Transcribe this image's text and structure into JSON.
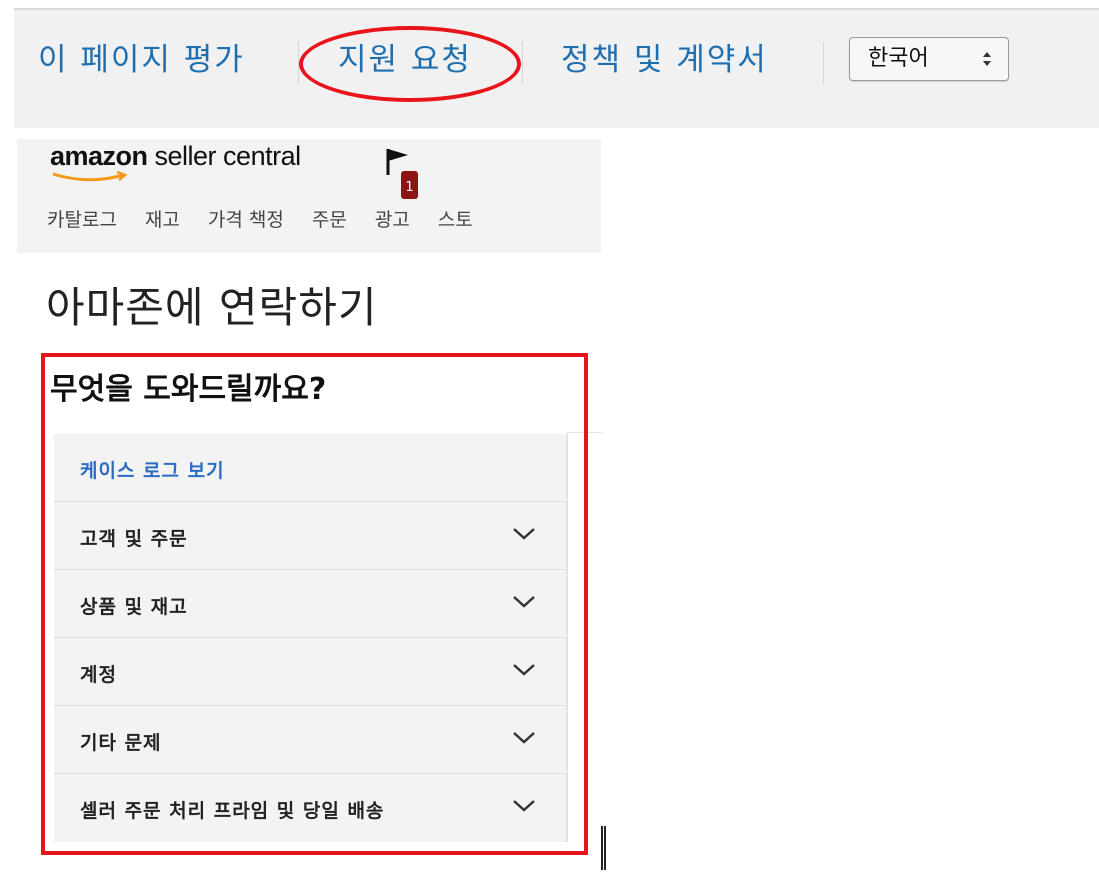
{
  "footer": {
    "links": [
      {
        "label": "이 페이지 평가"
      },
      {
        "label": "지원 요청"
      },
      {
        "label": "정책 및 계약서"
      }
    ],
    "language": "한국어"
  },
  "header": {
    "logo_bold": "amazon",
    "logo_rest": " seller central",
    "notification_count": "1",
    "nav": [
      "카탈로그",
      "재고",
      "가격 책정",
      "주문",
      "광고",
      "스토"
    ]
  },
  "page": {
    "title": "아마존에 연락하기",
    "help_title": "무엇을 도와드릴까요?",
    "items": [
      {
        "label": "케이스 로그 보기"
      },
      {
        "label": "고객 및 주문"
      },
      {
        "label": "상품 및 재고"
      },
      {
        "label": "계정"
      },
      {
        "label": "기타 문제"
      },
      {
        "label": "셀러 주문 처리 프라임 및 당일 배송"
      }
    ]
  },
  "colors": {
    "link": "#1f6fb0",
    "highlight": "#e8131b",
    "panel": "#f3f3f3"
  }
}
